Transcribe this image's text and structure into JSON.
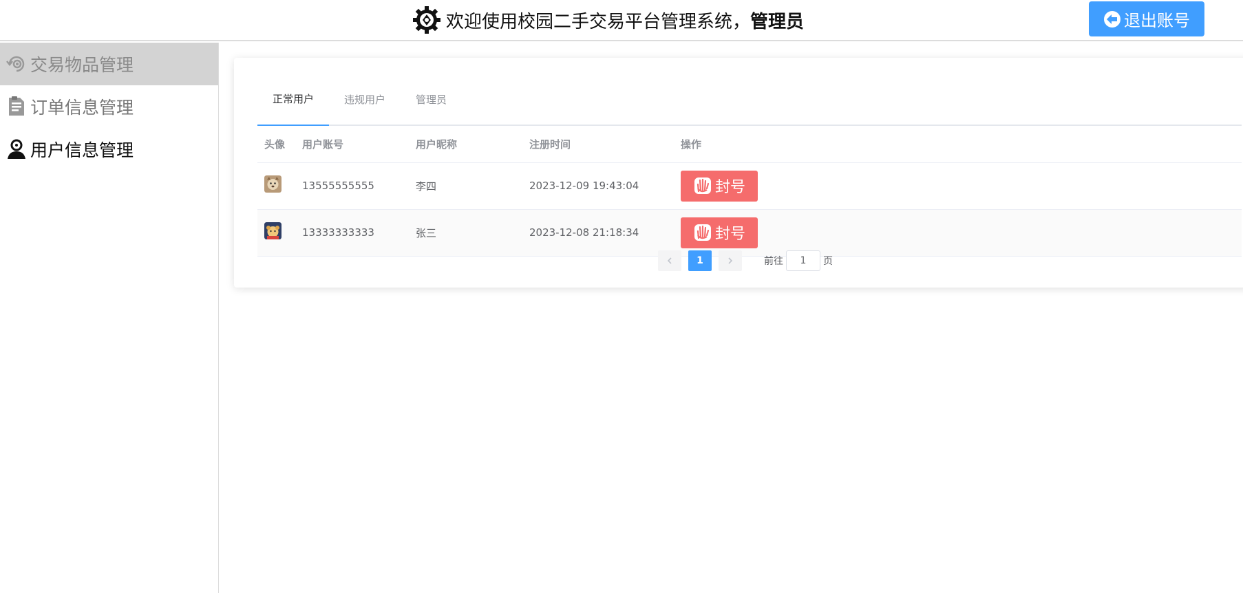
{
  "header": {
    "title_prefix": "欢迎使用校园二手交易平台管理系统，",
    "user_role": "管理员",
    "logout_label": "退出账号"
  },
  "sidebar": {
    "items": [
      {
        "label": "交易物品管理",
        "icon": "eye-refresh-icon"
      },
      {
        "label": "订单信息管理",
        "icon": "document-icon"
      },
      {
        "label": "用户信息管理",
        "icon": "user-icon"
      }
    ]
  },
  "tabs": [
    {
      "label": "正常用户"
    },
    {
      "label": "违规用户"
    },
    {
      "label": "管理员"
    }
  ],
  "table": {
    "headers": [
      "头像",
      "用户账号",
      "用户昵称",
      "注册时间",
      "操作"
    ],
    "rows": [
      {
        "account": "13555555555",
        "nickname": "李四",
        "registered": "2023-12-09 19:43:04",
        "action": "封号"
      },
      {
        "account": "13333333333",
        "nickname": "张三",
        "registered": "2023-12-08 21:18:34",
        "action": "封号"
      }
    ]
  },
  "pagination": {
    "current_page": "1",
    "goto_prefix": "前往",
    "goto_value": "1",
    "goto_suffix": "页"
  },
  "colors": {
    "primary": "#409eff",
    "danger": "#f56c6c",
    "sidebar_active": "#d3d3d3"
  }
}
